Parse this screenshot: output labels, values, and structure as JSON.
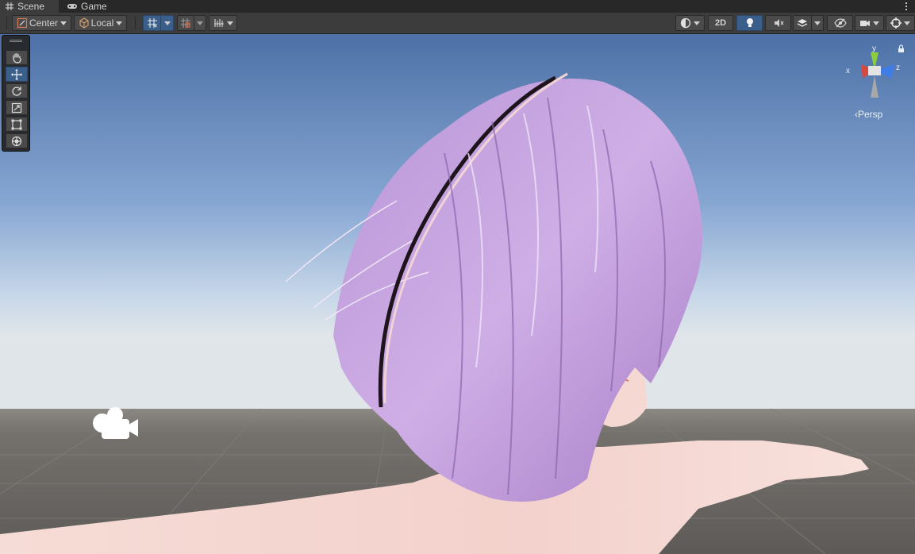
{
  "tabs": [
    {
      "label": "Scene",
      "icon": "grid-icon",
      "active": true
    },
    {
      "label": "Game",
      "icon": "gamepad-icon",
      "active": false
    }
  ],
  "toolbar": {
    "pivot_label": "Center",
    "space_label": "Local",
    "mode_2d_label": "2D"
  },
  "gizmo": {
    "projection_label": "Persp",
    "axis_x": "x",
    "axis_y": "y",
    "axis_z": "z"
  },
  "tools": [
    "hand-tool",
    "move-tool",
    "rotate-tool",
    "scale-tool",
    "rect-tool",
    "transform-tool"
  ],
  "colors": {
    "accent": "#3a5f8a",
    "axis_x": "#d6493f",
    "axis_y": "#8ccd3a",
    "axis_z": "#3e7ce8",
    "hair": "#c7a3dd",
    "skin": "#f4d3cf"
  }
}
